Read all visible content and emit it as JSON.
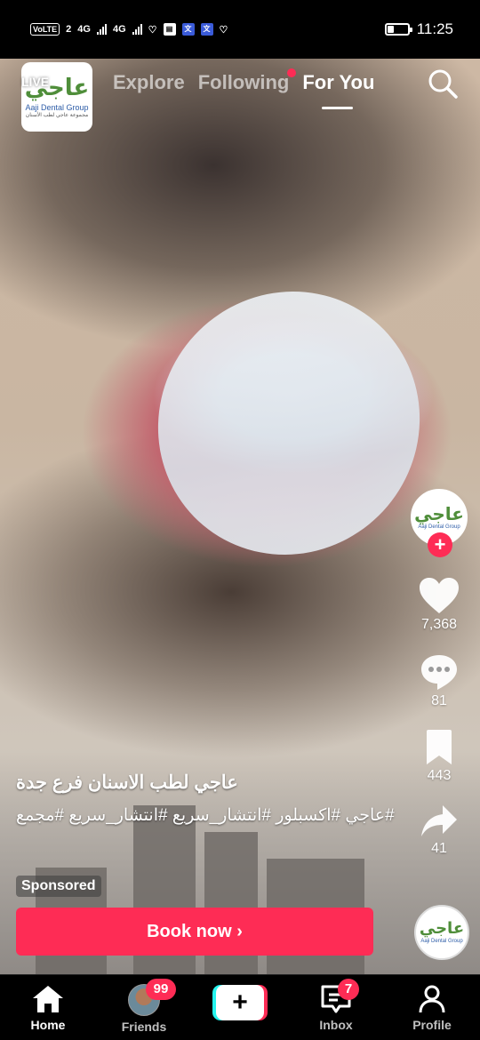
{
  "status_bar": {
    "carrier_tags": [
      "VoLTE",
      "2",
      "4G",
      "4G"
    ],
    "time": "11:25",
    "battery_level": 0.3
  },
  "header": {
    "live_label": "LIVE",
    "brand_logo_mark": "عاجي",
    "brand_logo_name": "Aaji Dental Group",
    "brand_logo_sub": "مجموعة عاجي لطب الأسنان",
    "tabs": [
      {
        "label": "Explore",
        "active": false
      },
      {
        "label": "Following",
        "active": false,
        "has_dot": true
      },
      {
        "label": "For You",
        "active": true
      }
    ]
  },
  "actions": {
    "likes": "7,368",
    "comments": "81",
    "saves": "443",
    "shares": "41"
  },
  "caption": {
    "title": "عاجي لطب الاسنان فرع جدة",
    "tags": "#عاجي #اكسبلور #انتشار_سريع #انتشار_سريع #مجمع",
    "sponsored": "Sponsored"
  },
  "cta": {
    "label": "Book now ›"
  },
  "bottom_nav": {
    "items": [
      {
        "label": "Home",
        "active": true
      },
      {
        "label": "Friends",
        "badge": "99"
      },
      {
        "label": "",
        "kind": "create"
      },
      {
        "label": "Inbox",
        "badge": "7"
      },
      {
        "label": "Profile"
      }
    ]
  },
  "colors": {
    "accent": "#fe2c55",
    "create_left": "#25f4ee"
  }
}
